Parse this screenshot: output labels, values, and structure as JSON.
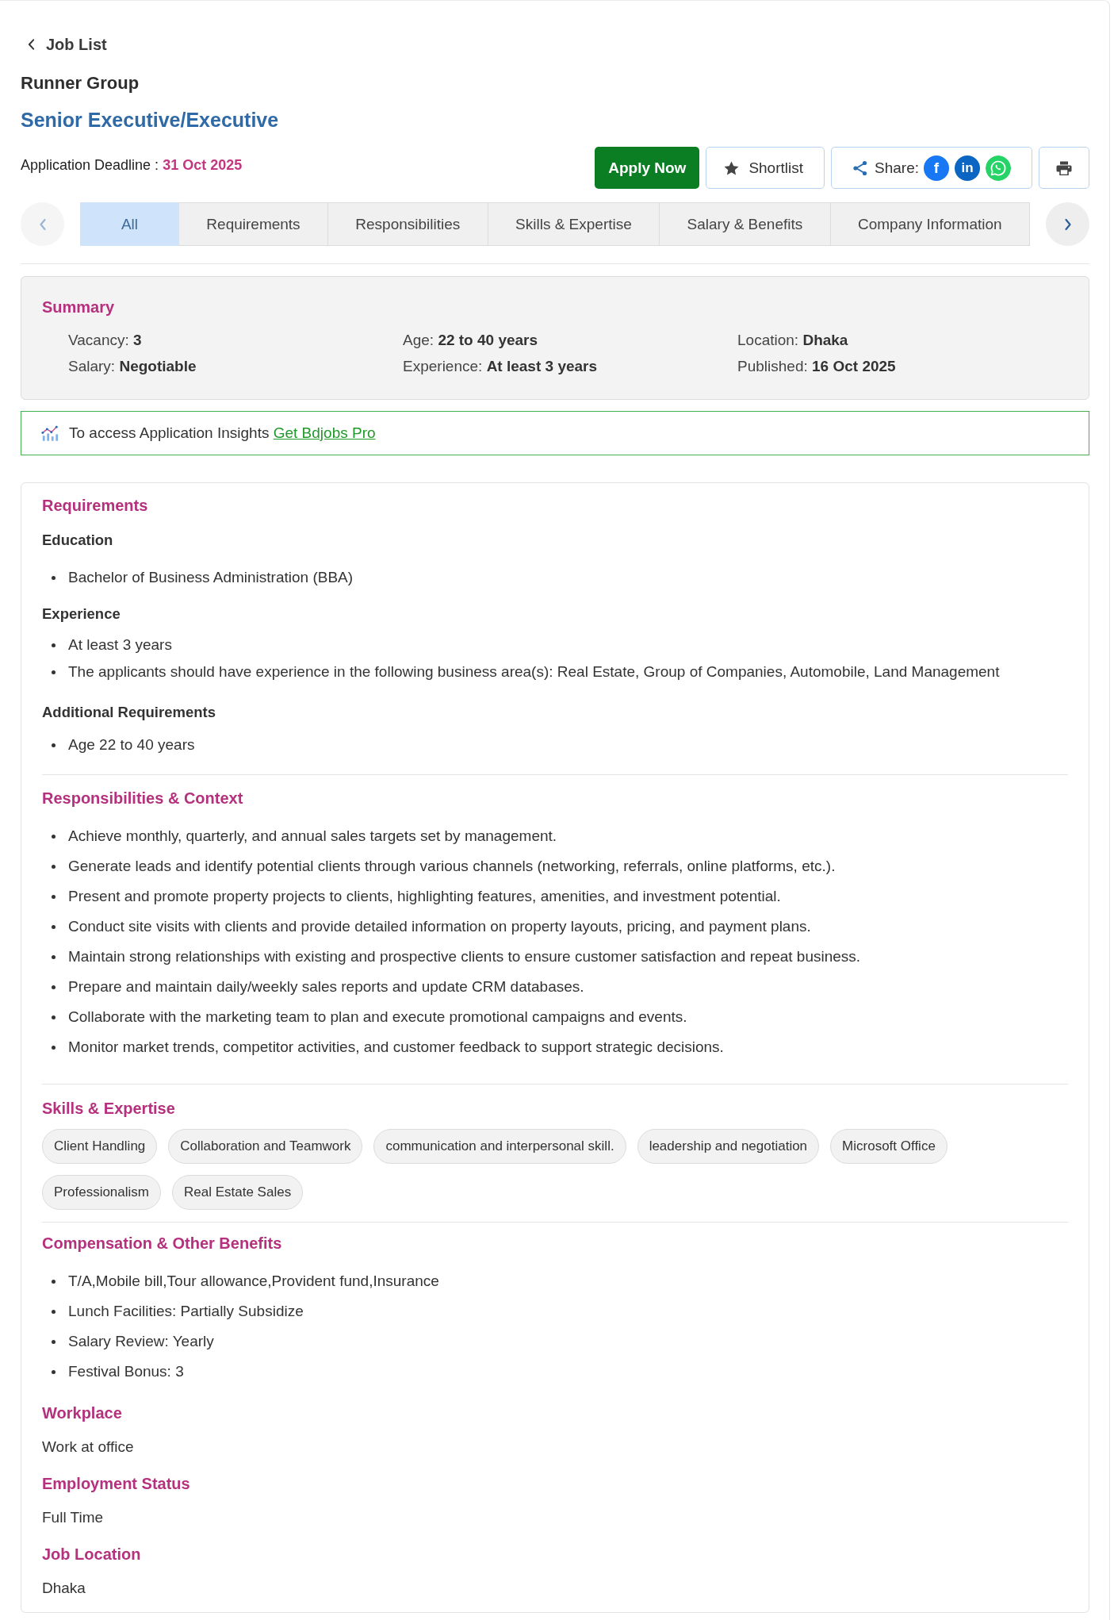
{
  "back_link": {
    "label": "Job List"
  },
  "company": "Runner Group",
  "job_title": "Senior Executive/Executive",
  "deadline": {
    "label": "Application Deadline :",
    "date": "31 Oct 2025"
  },
  "actions": [
    {
      "kind": "apply",
      "label": "Apply Now"
    },
    {
      "kind": "shortlist",
      "label": "Shortlist"
    },
    {
      "kind": "share",
      "label": "Share:",
      "networks": [
        {
          "kind": "facebook",
          "mark": "f"
        },
        {
          "kind": "linkedin",
          "mark": "in"
        },
        {
          "kind": "whatsapp"
        }
      ]
    },
    {
      "kind": "print"
    }
  ],
  "tab_nav": {
    "prev": {
      "disabled": true
    },
    "next": {
      "disabled": false
    }
  },
  "tabs": [
    {
      "label": "All",
      "selected": true
    },
    {
      "label": "Requirements",
      "selected": false
    },
    {
      "label": "Responsibilities",
      "selected": false
    },
    {
      "label": "Skills & Expertise",
      "selected": false
    },
    {
      "label": "Salary & Benefits",
      "selected": false
    },
    {
      "label": "Company Information",
      "selected": false
    }
  ],
  "summary": {
    "title": "Summary",
    "fields": [
      {
        "label": "Vacancy:",
        "value": "3"
      },
      {
        "label": "Age:",
        "value": "22 to 40 years"
      },
      {
        "label": "Location:",
        "value": "Dhaka"
      },
      {
        "label": "Salary:",
        "value": "Negotiable"
      },
      {
        "label": "Experience:",
        "value": "At least 3 years"
      },
      {
        "label": "Published:",
        "value": "16 Oct 2025"
      }
    ]
  },
  "insights": {
    "text": "To access Application Insights",
    "link": "Get Bdjobs Pro"
  },
  "sections": [
    {
      "kind": "groups",
      "title": "Requirements",
      "rule_below": true,
      "groups": [
        {
          "heading": "Education",
          "items": [
            "Bachelor of Business Administration (BBA)"
          ]
        },
        {
          "heading": "Experience",
          "items": [
            "At least 3 years",
            "The applicants should have experience in the following business area(s): Real Estate, Group of Companies, Automobile, Land Management"
          ]
        },
        {
          "heading": "Additional Requirements",
          "items": [
            "Age 22 to 40 years"
          ]
        }
      ]
    },
    {
      "kind": "bullets",
      "title": "Responsibilities & Context",
      "rule_below": true,
      "items": [
        "Achieve monthly, quarterly, and annual sales targets set by management.",
        "Generate leads and identify potential clients through various channels (networking, referrals, online platforms, etc.).",
        "Present and promote property projects to clients, highlighting features, amenities, and investment potential.",
        "Conduct site visits with clients and provide detailed information on property layouts, pricing, and payment plans.",
        "Maintain strong relationships with existing and prospective clients to ensure customer satisfaction and repeat business.",
        "Prepare and maintain daily/weekly sales reports and update CRM databases.",
        "Collaborate with the marketing team to plan and execute promotional campaigns and events.",
        "Monitor market trends, competitor activities, and customer feedback to support strategic decisions."
      ]
    },
    {
      "kind": "chips",
      "title": "Skills & Expertise",
      "rule_below": true,
      "items": [
        "Client Handling",
        "Collaboration and Teamwork",
        "communication and interpersonal skill.",
        "leadership and negotiation",
        "Microsoft Office",
        "Professionalism",
        "Real Estate Sales"
      ]
    },
    {
      "kind": "bullets",
      "title": "Compensation & Other Benefits",
      "rule_below": false,
      "items": [
        "T/A,Mobile bill,Tour allowance,Provident fund,Insurance",
        "Lunch Facilities: Partially Subsidize",
        "Salary Review: Yearly",
        "Festival Bonus: 3"
      ]
    },
    {
      "kind": "text",
      "title": "Workplace",
      "rule_below": false,
      "text": "Work at office"
    },
    {
      "kind": "text",
      "title": "Employment Status",
      "rule_below": false,
      "text": "Full Time"
    },
    {
      "kind": "text",
      "title": "Job Location",
      "rule_below": false,
      "text": "Dhaka"
    }
  ]
}
